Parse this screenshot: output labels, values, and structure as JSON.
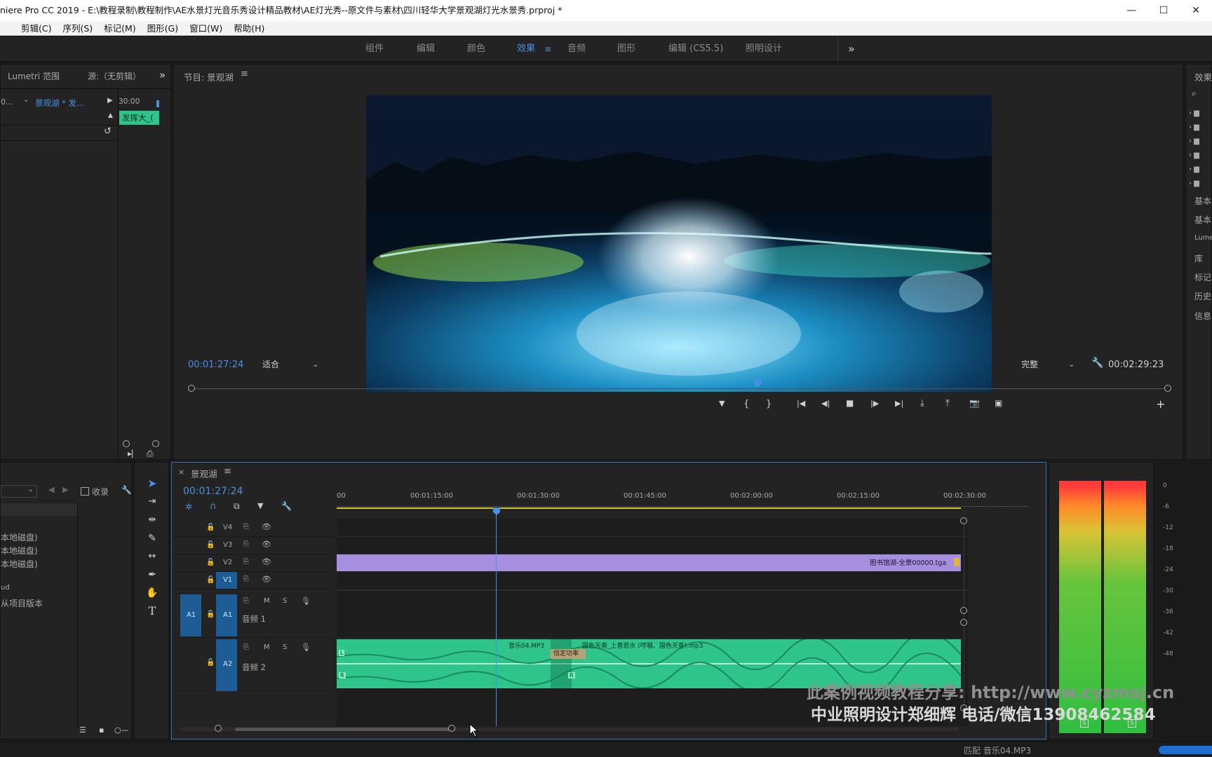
{
  "titlebar": {
    "title": "niere Pro CC 2019 - E:\\教程录制\\教程制作\\AE水景灯光音乐秀设计精品教材\\AE灯光秀--原文件与素材\\四川轻华大学景观湖灯光水景秀.prproj *",
    "minimize": "—",
    "maximize": "☐",
    "close": "✕"
  },
  "menu": [
    "剪辑(C)",
    "序列(S)",
    "标记(M)",
    "图形(G)",
    "窗口(W)",
    "帮助(H)"
  ],
  "workspaces": [
    "组件",
    "编辑",
    "颜色",
    "效果",
    "音频",
    "图形",
    "编辑 (CS5.5)",
    "照明设计"
  ],
  "workspace_active": "效果",
  "workspace_more": "»",
  "source_panel": {
    "tab1": "Lumetri 范围",
    "tab2": "源:（无剪辑）",
    "more": "»",
    "clip_dropdown": "景观湖 * 发...",
    "time_left": "0...",
    "time_ruler": "30:00",
    "clip_label": "发挥大_("
  },
  "program_monitor": {
    "title": "节目: 景观湖",
    "timecode_current": "00:01:27:24",
    "fit": "适合",
    "quality": "完整",
    "timecode_duration": "00:02:29:23",
    "playhead_fraction": 0.58
  },
  "transport": [
    "▼",
    "{",
    "}",
    "|◀",
    "◀|",
    "■",
    "|▶",
    "▶|",
    "⤓",
    "⤒",
    "📷",
    "▣"
  ],
  "add_button": "+",
  "project_panel": {
    "checkbox_label": "收录",
    "rows": [
      "本地磁盘)",
      "本地磁盘)",
      "本地磁盘)",
      "ud",
      "从项目版本"
    ]
  },
  "tools": [
    "selection-tool",
    "track-select-tool",
    "ripple-edit-tool",
    "razor-tool",
    "slip-tool",
    "pen-tool",
    "hand-tool",
    "type-tool"
  ],
  "timeline": {
    "tab": "景观湖",
    "close": "×",
    "timecode": "00:01:27:24",
    "ruler_labels": [
      "00",
      "00:01:15:00",
      "00:01:30:00",
      "00:01:45:00",
      "00:02:00:00",
      "00:02:15:00",
      "00:02:30:00"
    ],
    "tracks": [
      {
        "id": "V4",
        "type": "video"
      },
      {
        "id": "V3",
        "type": "video"
      },
      {
        "id": "V2",
        "type": "video"
      },
      {
        "id": "V1",
        "type": "video"
      },
      {
        "id": "A1",
        "type": "audio",
        "name": "音频 1"
      },
      {
        "id": "A2",
        "type": "audio",
        "name": "音频 2"
      }
    ],
    "mute": "M",
    "solo": "S",
    "v2_clip": "图书馆湖-全景00000.tga",
    "a2_clip1": "音乐04.MP3",
    "a2_clip2": "国色天香_上善若水 (哼唱、国色天香).mp3",
    "transition": "恒定功率",
    "channel_L": "L",
    "channel_R": "R"
  },
  "meter": {
    "labels": [
      "0",
      "-6",
      "-12",
      "-18",
      "-24",
      "-30",
      "-36",
      "-42",
      "-48"
    ],
    "solo_left": "S",
    "solo_right": "S"
  },
  "effects_panel": {
    "title": "效果",
    "rows": [
      "基本",
      "基本",
      "Lume",
      "库",
      "标记",
      "历史",
      "信息"
    ]
  },
  "watermark": {
    "line1": "此案例视频教程分享: http://www.cyzmsj.cn",
    "line2": "中业照明设计郑细辉 电话/微信13908462584"
  },
  "status": {
    "text": "匹配 音乐04.MP3"
  },
  "colors": {
    "accent": "#4a90e2",
    "video_clip": "#a78fdf",
    "audio_clip": "#2ec48a",
    "panel_bg": "#232323"
  }
}
